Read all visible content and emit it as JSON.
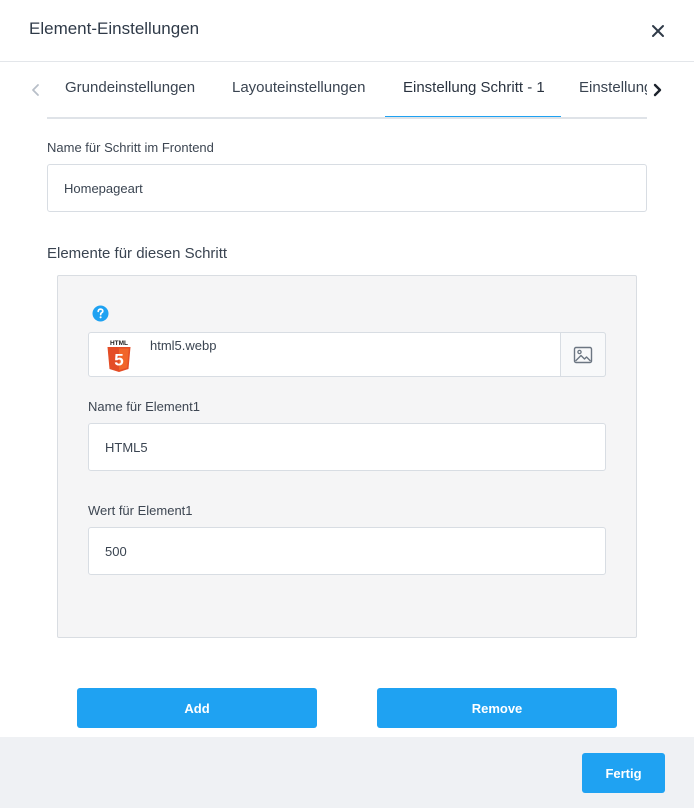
{
  "dialog": {
    "title": "Element-Einstellungen",
    "close_icon": "close-icon"
  },
  "tabs": {
    "items": [
      {
        "label": "Grundeinstellungen"
      },
      {
        "label": "Layouteinstellungen"
      },
      {
        "label": "Einstellung Schritt - 1",
        "active": true
      },
      {
        "label": "Einstellung"
      }
    ],
    "active_color": "#1fa2f2"
  },
  "step": {
    "frontend_name_label": "Name für Schritt im Frontend",
    "frontend_name_value": "Homepageart",
    "elements_heading": "Elemente für diesen Schritt"
  },
  "element": {
    "help_icon": "question-circle-icon",
    "file_name": "html5.webp",
    "file_thumb_text": "HTML",
    "file_thumb_digit": "5",
    "name_label": "Name für Element1",
    "name_value": "HTML5",
    "value_label": "Wert für Element1",
    "value_value": "500"
  },
  "actions": {
    "add_label": "Add",
    "remove_label": "Remove",
    "done_label": "Fertig"
  },
  "colors": {
    "accent": "#1fa2f2",
    "html5_orange": "#e44d26"
  }
}
